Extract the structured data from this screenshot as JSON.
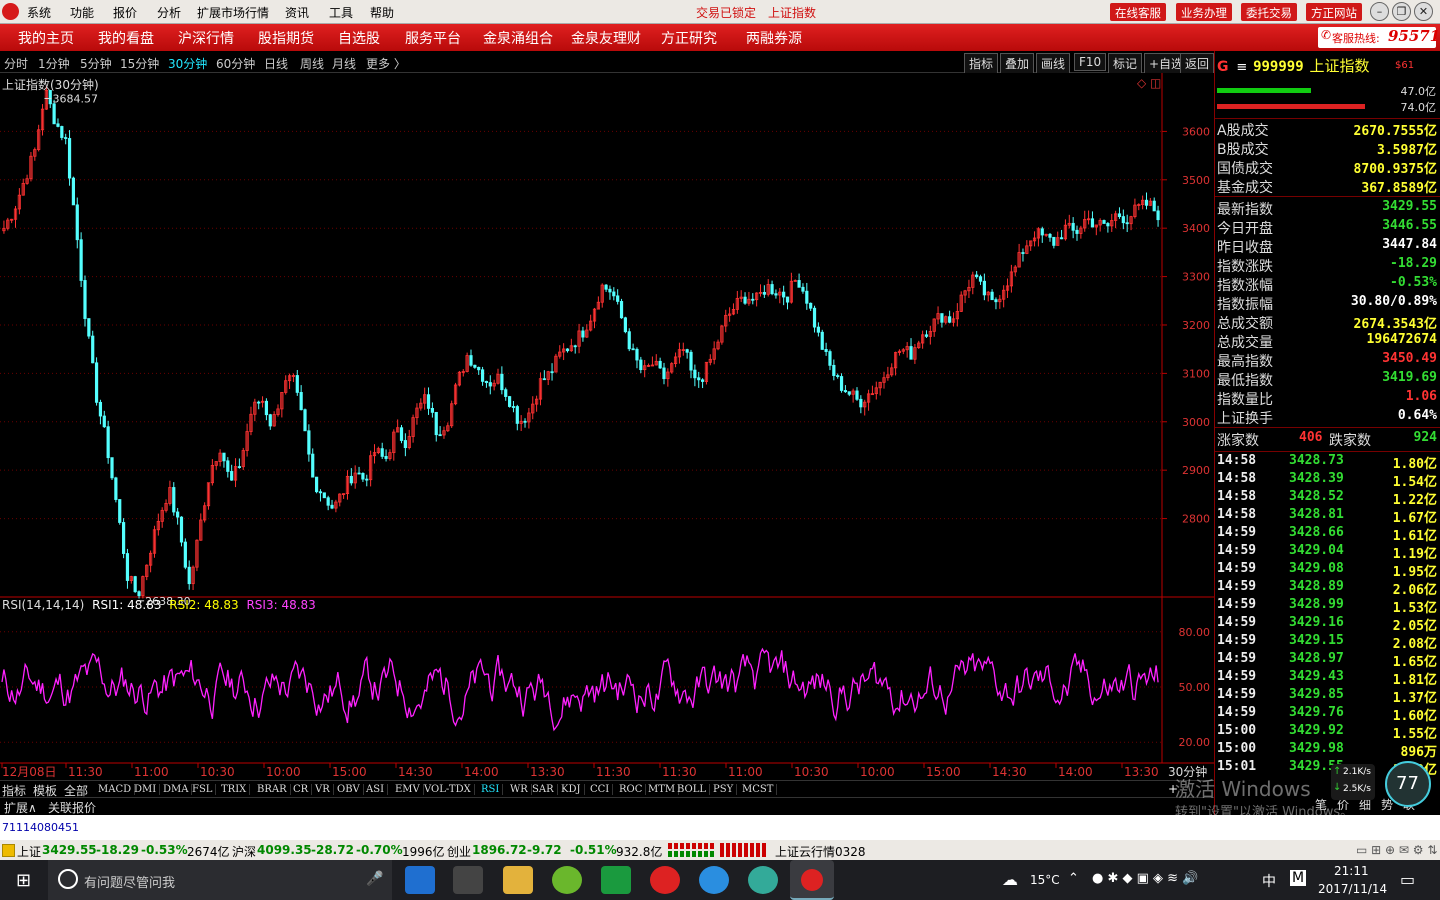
{
  "menubar": {
    "items": [
      "系统",
      "功能",
      "报价",
      "分析",
      "扩展市场行情",
      "资讯",
      "工具",
      "帮助"
    ],
    "status_locked": "交易已锁定",
    "status_index": "上证指数",
    "right_buttons": [
      "在线客服",
      "业务办理",
      "委托交易",
      "方正网站"
    ]
  },
  "nav": {
    "items": [
      "我的主页",
      "我的看盘",
      "沪深行情",
      "股指期货",
      "自选股",
      "服务平台",
      "金泉涌组合",
      "金泉友理财",
      "方正研究",
      "两融券源"
    ],
    "hotline_label": "客服热线:",
    "hotline_number": "95571"
  },
  "period_bar": {
    "periods": [
      "分时",
      "1分钟",
      "5分钟",
      "15分钟",
      "30分钟",
      "60分钟",
      "日线",
      "周线",
      "月线",
      "更多 〉"
    ],
    "active": "30分钟",
    "right_buttons": [
      "指标",
      "叠加",
      "画线",
      "F10",
      "标记",
      "+自选",
      "返回"
    ]
  },
  "main_chart": {
    "title": "上证指数(30分钟)",
    "high_label": "3684.57",
    "low_label": "2638.30",
    "y_ticks": [
      "3600",
      "3500",
      "3400",
      "3300",
      "3200",
      "3100",
      "3000",
      "2900",
      "2800"
    ],
    "y_values": [
      3600,
      3500,
      3400,
      3300,
      3200,
      3100,
      3000,
      2900,
      2800
    ],
    "x_labels": [
      "12月08日",
      "11:30",
      "11:00",
      "10:30",
      "10:00",
      "15:00",
      "14:30",
      "14:00",
      "13:30",
      "11:30",
      "11:30",
      "11:00",
      "10:30",
      "10:00",
      "15:00",
      "14:30",
      "14:00",
      "13:30"
    ],
    "x_right_label": "30分钟",
    "up_color": "#ff3232",
    "down_color": "#54ffff"
  },
  "chart_data": {
    "type": "candlestick",
    "series": [
      {
        "name": "上证指数",
        "close_path": [
          3400,
          3440,
          3500,
          3560,
          3684,
          3620,
          3580,
          3400,
          3200,
          3050,
          2950,
          2820,
          2680,
          2640,
          2720,
          2800,
          2860,
          2780,
          2660,
          2780,
          2900,
          2950,
          2870,
          2920,
          3020,
          3050,
          2990,
          3070,
          3090,
          3000,
          2880,
          2850,
          2820,
          2860,
          2900,
          2880,
          2940,
          2920,
          2980,
          2960,
          3020,
          3050,
          2980,
          3000,
          3080,
          3140,
          3110,
          3080,
          3090,
          3050,
          3000,
          3020,
          3080,
          3100,
          3140,
          3160,
          3180,
          3220,
          3280,
          3270,
          3210,
          3140,
          3100,
          3120,
          3090,
          3120,
          3150,
          3080,
          3100,
          3150,
          3210,
          3240,
          3260,
          3250,
          3280,
          3270,
          3260,
          3300,
          3250,
          3180,
          3120,
          3080,
          3060,
          3040,
          3060,
          3080,
          3120,
          3150,
          3140,
          3180,
          3200,
          3220,
          3210,
          3260,
          3300,
          3270,
          3240,
          3280,
          3310,
          3360,
          3390,
          3380,
          3370,
          3400,
          3390,
          3420,
          3410,
          3400,
          3430,
          3420,
          3440,
          3450,
          3430
        ]
      }
    ],
    "high": 3684.57,
    "low": 2638.3,
    "ylim": [
      2640,
      3700
    ]
  },
  "rsi": {
    "label": "RSI(14,14,14)",
    "rsi1": "RSI1: 48.83",
    "rsi2": "RSI2: 48.83",
    "rsi3": "RSI3: 48.83",
    "y_ticks": [
      "80.00",
      "50.00",
      "20.00"
    ],
    "y_values": [
      80,
      50,
      20
    ],
    "color": "#ff22ff"
  },
  "indicator_tabs": {
    "row1": [
      "指标",
      "模板",
      "全部",
      "MACD",
      "DMI",
      "DMA",
      "FSL",
      "TRIX",
      "BRAR",
      "CR",
      "VR",
      "OBV",
      "ASI",
      "EMV",
      "VOL-TDX",
      "RSI",
      "WR",
      "SAR",
      "KDJ",
      "CCI",
      "ROC",
      "MTM",
      "BOLL",
      "PSY",
      "MCST"
    ],
    "active": "RSI",
    "row2": [
      "扩展∧",
      "关联报价"
    ]
  },
  "right_panel": {
    "code": "999999",
    "name": "上证指数",
    "tag": "$61",
    "bar_pct": [
      "47.0亿",
      "74.0亿"
    ],
    "turnover": [
      {
        "k": "A股成交",
        "v": "2670.7555亿"
      },
      {
        "k": "B股成交",
        "v": "3.5987亿"
      },
      {
        "k": "国债成交",
        "v": "8700.9375亿"
      },
      {
        "k": "基金成交",
        "v": "367.8589亿"
      }
    ],
    "stats": [
      {
        "k": "最新指数",
        "v": "3429.55",
        "c": "dn"
      },
      {
        "k": "今日开盘",
        "v": "3446.55",
        "c": "dn"
      },
      {
        "k": "昨日收盘",
        "v": "3447.84",
        "c": "wt"
      },
      {
        "k": "指数涨跌",
        "v": "-18.29",
        "c": "dn"
      },
      {
        "k": "指数涨幅",
        "v": "-0.53%",
        "c": "dn"
      },
      {
        "k": "指数振幅",
        "v": "30.80/0.89%",
        "c": "wt"
      },
      {
        "k": "总成交额",
        "v": "2674.3543亿",
        "c": "yl"
      },
      {
        "k": "总成交量",
        "v": "196472674",
        "c": "yl"
      },
      {
        "k": "最高指数",
        "v": "3450.49",
        "c": "up"
      },
      {
        "k": "最低指数",
        "v": "3419.69",
        "c": "dn"
      },
      {
        "k": "指数量比",
        "v": "1.06",
        "c": "up"
      },
      {
        "k": "上证换手",
        "v": "0.64%",
        "c": "wt"
      }
    ],
    "up_label": "涨家数",
    "up_count": "406",
    "down_label": "跌家数",
    "down_count": "924",
    "ticks": [
      {
        "t": "14:58",
        "p": "3428.73",
        "a": "1.80亿"
      },
      {
        "t": "14:58",
        "p": "3428.39",
        "a": "1.54亿"
      },
      {
        "t": "14:58",
        "p": "3428.52",
        "a": "1.22亿"
      },
      {
        "t": "14:58",
        "p": "3428.81",
        "a": "1.67亿"
      },
      {
        "t": "14:59",
        "p": "3428.66",
        "a": "1.61亿"
      },
      {
        "t": "14:59",
        "p": "3429.04",
        "a": "1.19亿"
      },
      {
        "t": "14:59",
        "p": "3429.08",
        "a": "1.95亿"
      },
      {
        "t": "14:59",
        "p": "3428.89",
        "a": "2.06亿"
      },
      {
        "t": "14:59",
        "p": "3428.99",
        "a": "1.53亿"
      },
      {
        "t": "14:59",
        "p": "3429.16",
        "a": "2.05亿"
      },
      {
        "t": "14:59",
        "p": "3429.15",
        "a": "2.08亿"
      },
      {
        "t": "14:59",
        "p": "3428.97",
        "a": "1.65亿"
      },
      {
        "t": "14:59",
        "p": "3429.43",
        "a": "1.81亿"
      },
      {
        "t": "14:59",
        "p": "3429.85",
        "a": "1.37亿"
      },
      {
        "t": "14:59",
        "p": "3429.76",
        "a": "1.60亿"
      },
      {
        "t": "15:00",
        "p": "3429.92",
        "a": "1.55亿"
      },
      {
        "t": "15:00",
        "p": "3429.98",
        "a": "896万"
      },
      {
        "t": "15:01",
        "p": "3429.55",
        "a": "1.42亿"
      }
    ],
    "bottom_tabs": [
      "笔",
      "价",
      "细",
      "势",
      "联"
    ],
    "watermark1": "激活 Windows",
    "watermark2": "转到\"设置\"以激活 Windows。"
  },
  "network": {
    "up": "2.1K/s",
    "down": "2.5K/s",
    "pct": "77"
  },
  "white_bar_text": "71114080451",
  "statusbar": {
    "sh_label": "上证",
    "sh_val": "3429.55",
    "sh_chg": "-18.29",
    "sh_pct": "-0.53%",
    "sh_amt": "2674亿",
    "sz_label": "沪深",
    "sz_val": "4099.35",
    "sz_chg": "-28.72",
    "sz_pct": "-0.70%",
    "sz_amt": "1996亿",
    "cy_label": "创业",
    "cy_val": "1896.72",
    "cy_chg": "-9.72",
    "cy_pct": "-0.51%",
    "cy_amt": "932.8亿",
    "cloud": "上证云行情0328"
  },
  "taskbar": {
    "search_placeholder": "有问题尽管问我",
    "temp": "15°C",
    "ime": "中",
    "ime2": "M",
    "time": "21:11",
    "date": "2017/11/14"
  }
}
